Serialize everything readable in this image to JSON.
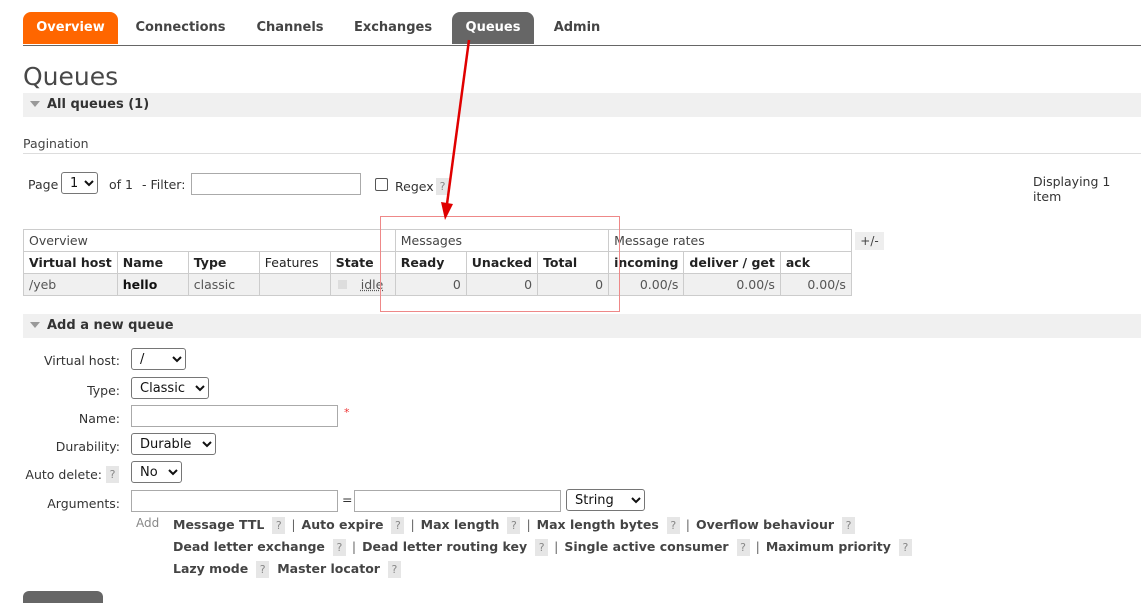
{
  "tabs": [
    "Overview",
    "Connections",
    "Channels",
    "Exchanges",
    "Queues",
    "Admin"
  ],
  "page_title": "Queues",
  "all_queues": "All queues (1)",
  "pagination": {
    "label": "Pagination",
    "page_label": "Page",
    "page_value": "1",
    "of_label": "of 1",
    "filter_label": "- Filter:",
    "regex_label": "Regex",
    "help": "?",
    "displaying": "Displaying 1 item"
  },
  "table": {
    "groups": [
      "Overview",
      "Messages",
      "Message rates"
    ],
    "toggle": "+/-",
    "headers": [
      "Virtual host",
      "Name",
      "Type",
      "Features",
      "State",
      "Ready",
      "Unacked",
      "Total",
      "incoming",
      "deliver / get",
      "ack"
    ],
    "row": {
      "vhost": "/yeb",
      "name": "hello",
      "type": "classic",
      "features": "",
      "state": "idle",
      "ready": "0",
      "unacked": "0",
      "total": "0",
      "incoming": "0.00/s",
      "deliver_get": "0.00/s",
      "ack": "0.00/s"
    }
  },
  "add_queue": {
    "title": "Add a new queue",
    "vhost_label": "Virtual host:",
    "vhost_value": "/",
    "type_label": "Type:",
    "type_value": "Classic",
    "name_label": "Name:",
    "required_mark": "*",
    "durability_label": "Durability:",
    "durability_value": "Durable",
    "autodelete_label": "Auto delete:",
    "autodelete_value": "No",
    "arguments_label": "Arguments:",
    "equals": "=",
    "arg_type_value": "String",
    "add_label": "Add",
    "arg_links_row1": [
      "Message TTL",
      "Auto expire",
      "Max length",
      "Max length bytes",
      "Overflow behaviour"
    ],
    "arg_links_row2": [
      "Dead letter exchange",
      "Dead letter routing key",
      "Single active consumer",
      "Maximum priority"
    ],
    "arg_links_row3": [
      "Lazy mode",
      "Master locator"
    ]
  },
  "colors": {
    "accent_orange": "#ff6600",
    "active_tab_grey": "#666666",
    "annotation_red": "#e00000"
  }
}
